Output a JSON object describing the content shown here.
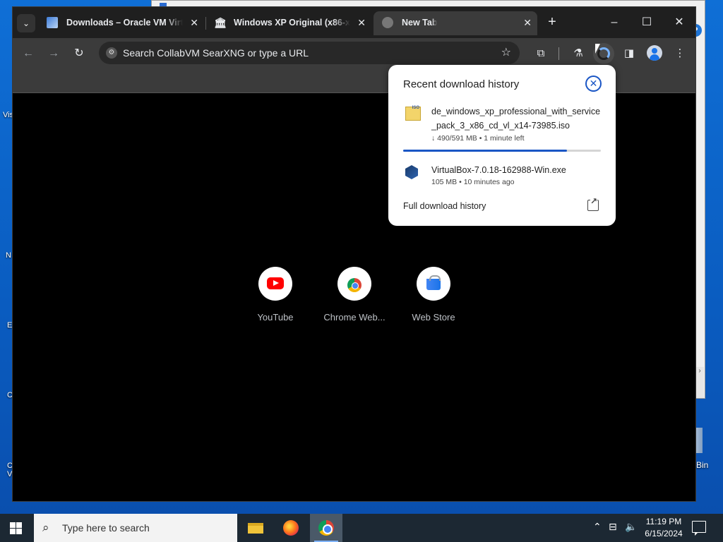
{
  "desktop": {
    "icon_labels": [
      "Vis",
      "N",
      "E",
      "C",
      "C V"
    ],
    "recycle_bin_label": "Bin"
  },
  "browser": {
    "tabs": [
      {
        "title": "Downloads – Oracle VM Virtua",
        "icon": "virtualbox-icon",
        "active": false
      },
      {
        "title": "Windows XP Original (x86-x64",
        "icon": "archive-org-icon",
        "active": false
      },
      {
        "title": "New Tab",
        "icon": "globe-icon",
        "active": true
      }
    ],
    "omnibox": {
      "placeholder": "Search CollabVM SearXNG or type a URL"
    },
    "shortcuts": [
      {
        "label": "YouTube",
        "icon": "youtube-icon"
      },
      {
        "label": "Chrome Web...",
        "icon": "chrome-web-icon"
      },
      {
        "label": "Web Store",
        "icon": "web-store-icon"
      }
    ]
  },
  "downloads_popup": {
    "title": "Recent download history",
    "items": [
      {
        "name": "de_windows_xp_professional_with_service_pack_3_x86_cd_vl_x14-73985.iso",
        "meta": "↓ 490/591 MB • 1 minute left",
        "progress": 0.83,
        "icon": "iso-file-icon"
      },
      {
        "name": "VirtualBox-7.0.18-162988-Win.exe",
        "meta": "105 MB • 10 minutes ago",
        "icon": "virtualbox-installer-icon"
      }
    ],
    "footer": "Full download history"
  },
  "taskbar": {
    "search_placeholder": "Type here to search",
    "time": "11:19 PM",
    "date": "6/15/2024"
  },
  "colors": {
    "accent_blue": "#1a56c5",
    "taskbar": "#1c2833",
    "desktop": "#0a5fc4"
  }
}
